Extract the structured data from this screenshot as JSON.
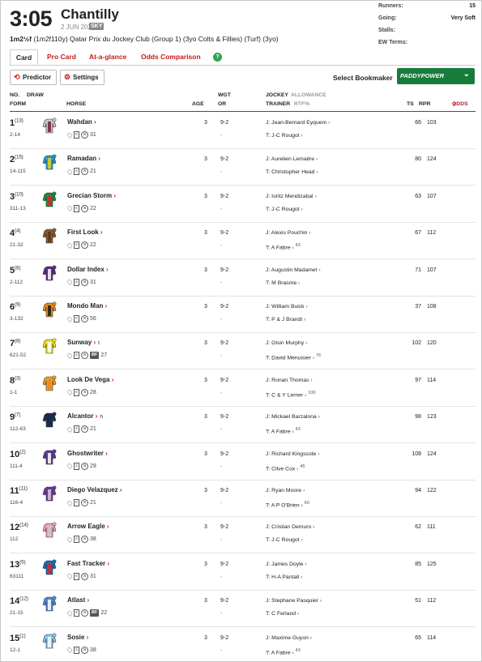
{
  "race": {
    "time": "3:05",
    "course": "Chantilly",
    "date": "2 JUN 2024",
    "channel": "SKY",
    "distance": "1m2½f",
    "distance_detail": "(1m2f110y)",
    "title": "Qatar Prix du Jockey Club (Group 1) (3yo Colts & Fillies) (Turf) (3yo)"
  },
  "meta": {
    "runners_label": "Runners:",
    "runners": "15",
    "going_label": "Going:",
    "going": "Very Soft",
    "stalls_label": "Stalls:",
    "stalls": "",
    "ew_label": "EW Terms:",
    "ew": ""
  },
  "tabs": [
    "Card",
    "Pro Card",
    "At-a-glance",
    "Odds Comparison"
  ],
  "help_icon": "?",
  "buttons": {
    "predictor": "Predictor",
    "settings": "Settings"
  },
  "bookmaker": {
    "label": "Select Bookmaker",
    "selected": "PADDYPOWER",
    "color": "#177c3a"
  },
  "headers": {
    "no": "NO.",
    "draw": "DRAW",
    "form": "FORM",
    "horse": "HORSE",
    "age": "AGE",
    "wgt": "WGT",
    "or": "OR",
    "jockey": "JOCKEY",
    "allowance": "ALLOWANCE",
    "trainer": "TRAINER",
    "rtf": "RTF%",
    "ts": "TS",
    "rpr": "RPR",
    "odds": "ODDS"
  },
  "runners": [
    {
      "no": "1",
      "draw": "(13)",
      "form": "2-14",
      "name": "Wahdan",
      "hg": "",
      "bf": false,
      "days": "31",
      "age": "3",
      "wgt": "9-2",
      "or": "-",
      "jockey": "J: Jean-Bernard Eyquem",
      "trainer": "T: J-C Rougot",
      "rtf": "",
      "ts": "66",
      "rpr": "103",
      "silk": [
        "#c8c8c8",
        "#7a1a2a",
        "#c8c8c8"
      ]
    },
    {
      "no": "2",
      "draw": "(15)",
      "form": "14-115",
      "name": "Ramadan",
      "hg": "",
      "bf": false,
      "days": "21",
      "age": "3",
      "wgt": "9-2",
      "or": "-",
      "jockey": "J: Aurelien Lemaitre",
      "trainer": "T: Christopher Head",
      "rtf": "",
      "ts": "80",
      "rpr": "124",
      "silk": [
        "#1f9bd6",
        "#e8d21a",
        "#1f9bd6"
      ]
    },
    {
      "no": "3",
      "draw": "(10)",
      "form": "311-13",
      "name": "Grecian Storm",
      "hg": "",
      "bf": false,
      "days": "22",
      "age": "3",
      "wgt": "9-2",
      "or": "-",
      "jockey": "J: Ioritz Mendizabal",
      "trainer": "T: J-C Rougot",
      "rtf": "",
      "ts": "63",
      "rpr": "107",
      "silk": [
        "#1e8a3a",
        "#d42a2a",
        "#1e8a3a"
      ]
    },
    {
      "no": "4",
      "draw": "(4)",
      "form": "21-32",
      "name": "First Look",
      "hg": "",
      "bf": false,
      "days": "22",
      "age": "3",
      "wgt": "9-2",
      "or": "-",
      "jockey": "J: Alexis Pouchin",
      "trainer": "T: A Fabre",
      "rtf": "43",
      "ts": "67",
      "rpr": "112",
      "silk": [
        "#8a5a2a",
        "#5a3a1a",
        "#8a5a2a"
      ]
    },
    {
      "no": "5",
      "draw": "(6)",
      "form": "2-112",
      "name": "Dollar Index",
      "hg": "",
      "bf": false,
      "days": "31",
      "age": "3",
      "wgt": "9-2",
      "or": "-",
      "jockey": "J: Augustin Madamet",
      "trainer": "T: M Brasme",
      "rtf": "",
      "ts": "71",
      "rpr": "107",
      "silk": [
        "#5a2a8a",
        "#ffffff",
        "#5a2a8a"
      ]
    },
    {
      "no": "6",
      "draw": "(9)",
      "form": "3-132",
      "name": "Mondo Man",
      "hg": "",
      "bf": false,
      "days": "56",
      "age": "3",
      "wgt": "9-2",
      "or": "-",
      "jockey": "J: William Buick",
      "trainer": "T: P & J Brandt",
      "rtf": "",
      "ts": "37",
      "rpr": "108",
      "silk": [
        "#e88a1a",
        "#1a1a1a",
        "#e88a1a"
      ]
    },
    {
      "no": "7",
      "draw": "(8)",
      "form": "621-52",
      "name": "Sunway",
      "hg": "t",
      "bf": true,
      "days": "27",
      "age": "3",
      "wgt": "9-2",
      "or": "-",
      "jockey": "J: Oisin Murphy",
      "trainer": "T: David Menuisier",
      "rtf": "76",
      "ts": "102",
      "rpr": "120",
      "silk": [
        "#f0e020",
        "#ffffff",
        "#f0e020"
      ]
    },
    {
      "no": "8",
      "draw": "(3)",
      "form": "1-1",
      "name": "Look De Vega",
      "hg": "",
      "bf": false,
      "days": "28",
      "age": "3",
      "wgt": "9-2",
      "or": "-",
      "jockey": "J: Ronan Thomas",
      "trainer": "T: C & Y Lerner",
      "rtf": "100",
      "ts": "97",
      "rpr": "114",
      "silk": [
        "#f09a2a",
        "#e88a1a",
        "#f09a2a"
      ]
    },
    {
      "no": "9",
      "draw": "(7)",
      "form": "112-63",
      "name": "Alcantor",
      "hg": "h",
      "bf": false,
      "days": "21",
      "age": "3",
      "wgt": "9-2",
      "or": "-",
      "jockey": "J: Mickael Barzalona",
      "trainer": "T: A Fabre",
      "rtf": "43",
      "ts": "98",
      "rpr": "123",
      "silk": [
        "#1a2a4a",
        "#1a2a4a",
        "#1a2a4a"
      ]
    },
    {
      "no": "10",
      "draw": "(2)",
      "form": "111-4",
      "name": "Ghostwriter",
      "hg": "",
      "bf": false,
      "days": "29",
      "age": "3",
      "wgt": "9-2",
      "or": "-",
      "jockey": "J: Richard Kingscote",
      "trainer": "T: Clive Cox",
      "rtf": "45",
      "ts": "108",
      "rpr": "124",
      "silk": [
        "#5a3a9a",
        "#ffffff",
        "#5a3a9a"
      ]
    },
    {
      "no": "11",
      "draw": "(11)",
      "form": "116-4",
      "name": "Diego Velazquez",
      "hg": "",
      "bf": false,
      "days": "21",
      "age": "3",
      "wgt": "9-2",
      "or": "-",
      "jockey": "J: Ryan Moore",
      "trainer": "T: A P O'Brien",
      "rtf": "60",
      "ts": "94",
      "rpr": "122",
      "silk": [
        "#6a3a9a",
        "#d8c8e8",
        "#6a3a9a"
      ]
    },
    {
      "no": "12",
      "draw": "(14)",
      "form": "112",
      "name": "Arrow Eagle",
      "hg": "",
      "bf": false,
      "days": "38",
      "age": "3",
      "wgt": "9-2",
      "or": "-",
      "jockey": "J: Cristian Demuro",
      "trainer": "T: J-C Rougot",
      "rtf": "",
      "ts": "62",
      "rpr": "111",
      "silk": [
        "#f0a0b8",
        "#c8c8c8",
        "#f0a0b8"
      ]
    },
    {
      "no": "13",
      "draw": "(5)",
      "form": "63111",
      "name": "Fast Tracker",
      "hg": "",
      "bf": false,
      "days": "31",
      "age": "3",
      "wgt": "9-2",
      "or": "-",
      "jockey": "J: James Doyle",
      "trainer": "T: H-A Pantall",
      "rtf": "",
      "ts": "85",
      "rpr": "125",
      "silk": [
        "#1a6ab8",
        "#d42a2a",
        "#1a6ab8"
      ]
    },
    {
      "no": "14",
      "draw": "(12)",
      "form": "21-15",
      "name": "Atlast",
      "hg": "",
      "bf": true,
      "days": "22",
      "age": "3",
      "wgt": "9-2",
      "or": "-",
      "jockey": "J: Stephane Pasquier",
      "trainer": "T: C Ferland",
      "rtf": "",
      "ts": "51",
      "rpr": "112",
      "silk": [
        "#4a8ad8",
        "#ffffff",
        "#4a8ad8"
      ]
    },
    {
      "no": "15",
      "draw": "(1)",
      "form": "12-1",
      "name": "Sosie",
      "hg": "",
      "bf": false,
      "days": "38",
      "age": "3",
      "wgt": "9-2",
      "or": "-",
      "jockey": "J: Maxime Guyon",
      "trainer": "T: A Fabre",
      "rtf": "43",
      "ts": "65",
      "rpr": "114",
      "silk": [
        "#8ac8e8",
        "#ffffff",
        "#8ac8e8"
      ]
    }
  ]
}
